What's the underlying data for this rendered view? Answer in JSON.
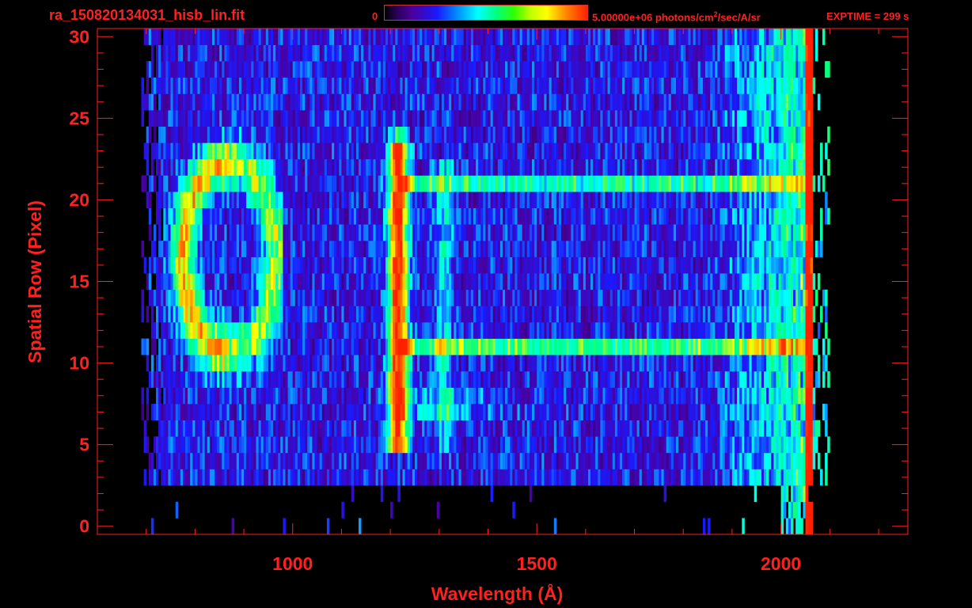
{
  "header": {
    "filename": "ra_150820134031_hisb_lin.fit",
    "colorbar_min": "0",
    "colorbar_max_label_pre": "5.00000e+06 photons/cm",
    "colorbar_max_label_sup": "2",
    "colorbar_max_label_post": "/sec/A/sr",
    "exptime": "EXPTIME = 299 s"
  },
  "colors": {
    "axis": "#ff2020",
    "background": "#000000",
    "colormap": [
      "#000000",
      "#4a00a0",
      "#1a1aff",
      "#00ffff",
      "#00ff80",
      "#ffff00",
      "#ff8000",
      "#ff2000"
    ]
  },
  "chart_data": {
    "type": "heatmap",
    "title": "ra_150820134031_hisb_lin.fit",
    "xlabel": "Wavelength (Å)",
    "ylabel": "Spatial Row (Pixel)",
    "xlim": [
      600,
      2260
    ],
    "ylim": [
      -0.5,
      30.5
    ],
    "x_major_ticks": [
      1000,
      1500,
      2000
    ],
    "x_tick_labels": [
      "1000",
      "1500",
      "2000"
    ],
    "y_major_ticks": [
      0,
      5,
      10,
      15,
      20,
      25,
      30
    ],
    "y_tick_labels": [
      "0",
      "5",
      "10",
      "15",
      "20",
      "25",
      "30"
    ],
    "colorbar_range": [
      0,
      5000000
    ],
    "colorbar_unit": "photons/cm²/sec/A/sr",
    "features": [
      {
        "name": "Lyman-alpha line",
        "x": 1216,
        "rows": [
          5,
          24
        ],
        "level": "high"
      },
      {
        "name": "bright emission edge",
        "x": 2060,
        "rows": [
          2,
          30
        ],
        "level": "high"
      },
      {
        "name": "arc structure",
        "x": [
          790,
          960
        ],
        "rows": [
          11,
          23
        ],
        "level": "high"
      },
      {
        "name": "horizontal band",
        "x": [
          1216,
          2060
        ],
        "rows": [
          11,
          11
        ],
        "level": "medium"
      },
      {
        "name": "horizontal band",
        "x": [
          1216,
          2060
        ],
        "rows": [
          21,
          21
        ],
        "level": "medium"
      }
    ]
  }
}
